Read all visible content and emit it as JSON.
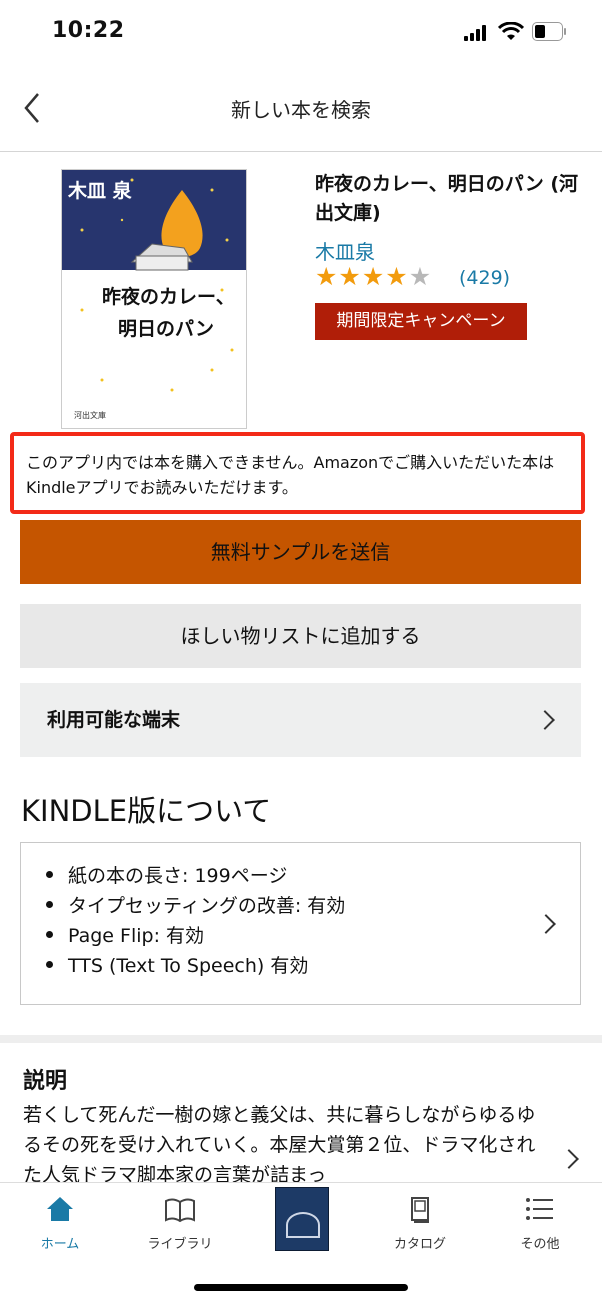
{
  "status_bar": {
    "time": "10:22"
  },
  "nav": {
    "title": "新しい本を検索"
  },
  "book": {
    "cover": {
      "author": "木皿 泉",
      "title_line1": "昨夜のカレー、",
      "title_line2": "明日のパン",
      "publisher": "河出文庫"
    },
    "title": "昨夜のカレー、明日のパン (河出文庫)",
    "author": "木皿泉",
    "rating": 4,
    "rating_max": 5,
    "review_count": "(429)",
    "campaign_badge": "期間限定キャンペーン"
  },
  "notice": {
    "text": "このアプリ内では本を購入できません。Amazonでご購入いただいた本はKindleアプリでお読みいただけます。"
  },
  "buttons": {
    "sample": "無料サンプルを送信",
    "wishlist": "ほしい物リストに追加する",
    "devices": "利用可能な端末"
  },
  "kindle": {
    "heading": "KINDLE版について",
    "features": [
      "紙の本の長さ: 199ページ",
      "タイプセッティングの改善: 有効",
      "Page Flip: 有効",
      "TTS (Text To Speech) 有効"
    ]
  },
  "description": {
    "heading": "説明",
    "text": "若くして死んだ一樹の嫁と義父は、共に暮らしながらゆるゆるその死を受け入れていく。本屋大賞第２位、ドラマ化された人気ドラマ脚本家の言葉が詰まっ"
  },
  "tab_bar": {
    "items": [
      {
        "label": "ホーム",
        "icon": "home-icon",
        "active": true
      },
      {
        "label": "ライブラリ",
        "icon": "book-icon",
        "active": false
      },
      {
        "label": "",
        "icon": "current-book-cover",
        "active": false
      },
      {
        "label": "カタログ",
        "icon": "catalog-icon",
        "active": false
      },
      {
        "label": "その他",
        "icon": "menu-icon",
        "active": false
      }
    ]
  },
  "colors": {
    "accent_link": "#1a7aa6",
    "sample_button": "#c55500",
    "campaign_badge": "#b01e08",
    "notice_border": "#f32a18",
    "star": "#f29b0d",
    "home_tab": "#1a7aa6"
  }
}
